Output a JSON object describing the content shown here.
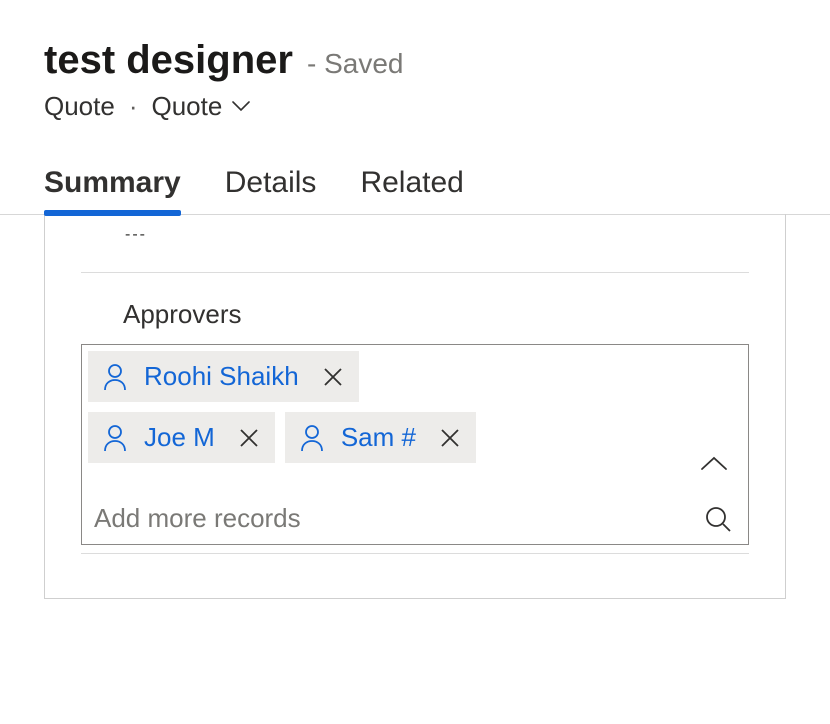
{
  "header": {
    "title": "test designer",
    "saved_label": "- Saved",
    "entity_label": "Quote",
    "form_label": "Quote"
  },
  "tabs": {
    "summary": "Summary",
    "details": "Details",
    "related": "Related"
  },
  "field": {
    "label": "Approvers",
    "placeholder": "Add more records",
    "placeholder_text": "---"
  },
  "approvers": [
    {
      "name": "Roohi Shaikh"
    },
    {
      "name": "Joe M"
    },
    {
      "name": "Sam #"
    }
  ]
}
